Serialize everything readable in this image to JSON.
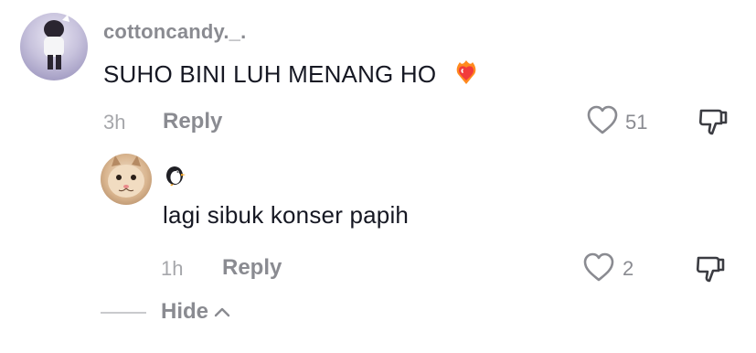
{
  "comment": {
    "username": "cottoncandy._.",
    "text": "SUHO BINI LUH MENANG HO",
    "emoji_icon": "heart-on-fire-icon",
    "time": "3h",
    "reply_label": "Reply",
    "likes": "51"
  },
  "reply": {
    "username_icon": "penguin-icon",
    "text": "lagi sibuk konser papih",
    "time": "1h",
    "reply_label": "Reply",
    "likes": "2"
  },
  "hide_label": "Hide",
  "colors": {
    "text": "#161823",
    "muted": "#8a8b91",
    "time": "#a6a7ab"
  }
}
